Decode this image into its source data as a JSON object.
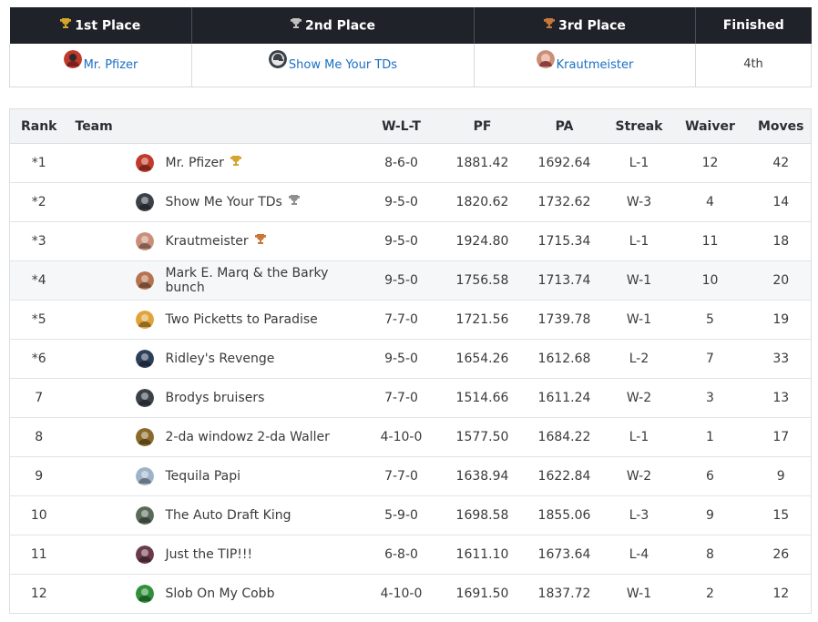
{
  "podium": {
    "headers": {
      "first": "1st Place",
      "second": "2nd Place",
      "third": "3rd Place",
      "finished": "Finished"
    },
    "first_team": "Mr. Pfizer",
    "second_team": "Show Me Your TDs",
    "third_team": "Krautmeister",
    "finished_value": "4th",
    "colors": {
      "gold": "#d4a52a",
      "silver": "#8f8f8f",
      "bronze": "#b36a2b"
    }
  },
  "standings": {
    "columns": {
      "rank": "Rank",
      "team": "Team",
      "wlt": "W-L-T",
      "pf": "PF",
      "pa": "PA",
      "streak": "Streak",
      "waiver": "Waiver",
      "moves": "Moves"
    },
    "rows": [
      {
        "rank": "*1",
        "team": "Mr. Pfizer",
        "trophy": "gold",
        "wlt": "8-6-0",
        "pf": "1881.42",
        "pa": "1692.64",
        "streak": "L-1",
        "waiver": "12",
        "moves": "42",
        "avatar": "#c0392b"
      },
      {
        "rank": "*2",
        "team": "Show Me Your TDs",
        "trophy": "silver",
        "wlt": "9-5-0",
        "pf": "1820.62",
        "pa": "1732.62",
        "streak": "W-3",
        "waiver": "4",
        "moves": "14",
        "avatar": "#3b4148"
      },
      {
        "rank": "*3",
        "team": "Krautmeister",
        "trophy": "bronze",
        "wlt": "9-5-0",
        "pf": "1924.80",
        "pa": "1715.34",
        "streak": "L-1",
        "waiver": "11",
        "moves": "18",
        "avatar": "#c98f7a"
      },
      {
        "rank": "*4",
        "team": "Mark E. Marq & the Barky bunch",
        "trophy": "",
        "wlt": "9-5-0",
        "pf": "1756.58",
        "pa": "1713.74",
        "streak": "W-1",
        "waiver": "10",
        "moves": "20",
        "avatar": "#b5734f"
      },
      {
        "rank": "*5",
        "team": "Two Picketts to Paradise",
        "trophy": "",
        "wlt": "7-7-0",
        "pf": "1721.56",
        "pa": "1739.78",
        "streak": "W-1",
        "waiver": "5",
        "moves": "19",
        "avatar": "#e0a43a"
      },
      {
        "rank": "*6",
        "team": "Ridley's Revenge",
        "trophy": "",
        "wlt": "9-5-0",
        "pf": "1654.26",
        "pa": "1612.68",
        "streak": "L-2",
        "waiver": "7",
        "moves": "33",
        "avatar": "#2c3e58"
      },
      {
        "rank": "7",
        "team": "Brodys bruisers",
        "trophy": "",
        "wlt": "7-7-0",
        "pf": "1514.66",
        "pa": "1611.24",
        "streak": "W-2",
        "waiver": "3",
        "moves": "13",
        "avatar": "#3b4148"
      },
      {
        "rank": "8",
        "team": "2-da windowz 2-da Waller",
        "trophy": "",
        "wlt": "4-10-0",
        "pf": "1577.50",
        "pa": "1684.22",
        "streak": "L-1",
        "waiver": "1",
        "moves": "17",
        "avatar": "#8a6a2a"
      },
      {
        "rank": "9",
        "team": "Tequila Papi",
        "trophy": "",
        "wlt": "7-7-0",
        "pf": "1638.94",
        "pa": "1622.84",
        "streak": "W-2",
        "waiver": "6",
        "moves": "9",
        "avatar": "#9fb3c8"
      },
      {
        "rank": "10",
        "team": "The Auto Draft King",
        "trophy": "",
        "wlt": "5-9-0",
        "pf": "1698.58",
        "pa": "1855.06",
        "streak": "L-3",
        "waiver": "9",
        "moves": "15",
        "avatar": "#5a6a5a"
      },
      {
        "rank": "11",
        "team": "Just the TIP!!!",
        "trophy": "",
        "wlt": "6-8-0",
        "pf": "1611.10",
        "pa": "1673.64",
        "streak": "L-4",
        "waiver": "8",
        "moves": "26",
        "avatar": "#6b3a4a"
      },
      {
        "rank": "12",
        "team": "Slob On My Cobb",
        "trophy": "",
        "wlt": "4-10-0",
        "pf": "1691.50",
        "pa": "1837.72",
        "streak": "W-1",
        "waiver": "2",
        "moves": "12",
        "avatar": "#2f8f3a"
      }
    ]
  }
}
